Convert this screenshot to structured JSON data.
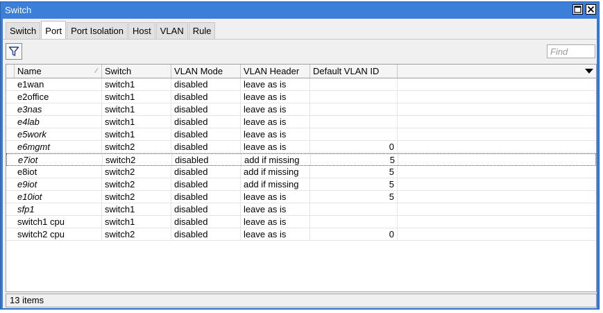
{
  "window": {
    "title": "Switch"
  },
  "tabs": [
    {
      "label": "Switch",
      "active": false
    },
    {
      "label": "Port",
      "active": true
    },
    {
      "label": "Port Isolation",
      "active": false
    },
    {
      "label": "Host",
      "active": false
    },
    {
      "label": "VLAN",
      "active": false
    },
    {
      "label": "Rule",
      "active": false
    }
  ],
  "toolbar": {
    "filter_icon": "filter-funnel-icon",
    "find_placeholder": "Find"
  },
  "table": {
    "columns": [
      "Name",
      "Switch",
      "VLAN Mode",
      "VLAN Header",
      "Default VLAN ID"
    ],
    "rows": [
      {
        "name": "e1wan",
        "italic": false,
        "switch": "switch1",
        "vlan_mode": "disabled",
        "vlan_header": "leave as is",
        "default_vlan_id": ""
      },
      {
        "name": "e2office",
        "italic": false,
        "switch": "switch1",
        "vlan_mode": "disabled",
        "vlan_header": "leave as is",
        "default_vlan_id": ""
      },
      {
        "name": "e3nas",
        "italic": true,
        "switch": "switch1",
        "vlan_mode": "disabled",
        "vlan_header": "leave as is",
        "default_vlan_id": ""
      },
      {
        "name": "e4lab",
        "italic": true,
        "switch": "switch1",
        "vlan_mode": "disabled",
        "vlan_header": "leave as is",
        "default_vlan_id": ""
      },
      {
        "name": "e5work",
        "italic": true,
        "switch": "switch1",
        "vlan_mode": "disabled",
        "vlan_header": "leave as is",
        "default_vlan_id": ""
      },
      {
        "name": "e6mgmt",
        "italic": true,
        "switch": "switch2",
        "vlan_mode": "disabled",
        "vlan_header": "leave as is",
        "default_vlan_id": "0"
      },
      {
        "name": "e7iot",
        "italic": true,
        "switch": "switch2",
        "vlan_mode": "disabled",
        "vlan_header": "add if missing",
        "default_vlan_id": "5",
        "selected": true
      },
      {
        "name": "e8iot",
        "italic": false,
        "switch": "switch2",
        "vlan_mode": "disabled",
        "vlan_header": "add if missing",
        "default_vlan_id": "5"
      },
      {
        "name": "e9iot",
        "italic": true,
        "switch": "switch2",
        "vlan_mode": "disabled",
        "vlan_header": "add if missing",
        "default_vlan_id": "5"
      },
      {
        "name": "e10iot",
        "italic": true,
        "switch": "switch2",
        "vlan_mode": "disabled",
        "vlan_header": "leave as is",
        "default_vlan_id": "5"
      },
      {
        "name": "sfp1",
        "italic": true,
        "switch": "switch1",
        "vlan_mode": "disabled",
        "vlan_header": "leave as is",
        "default_vlan_id": ""
      },
      {
        "name": "switch1 cpu",
        "italic": false,
        "switch": "switch1",
        "vlan_mode": "disabled",
        "vlan_header": "leave as is",
        "default_vlan_id": ""
      },
      {
        "name": "switch2 cpu",
        "italic": false,
        "switch": "switch2",
        "vlan_mode": "disabled",
        "vlan_header": "leave as is",
        "default_vlan_id": "0"
      }
    ]
  },
  "status": {
    "count_text": "13 items"
  },
  "colors": {
    "titlebar": "#3c7fd9",
    "window_bg": "#f0f0f0"
  }
}
